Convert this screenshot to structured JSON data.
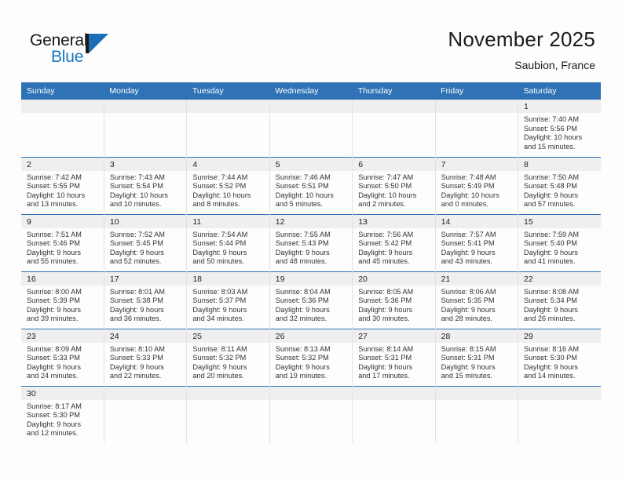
{
  "brand": {
    "name_part1": "General",
    "name_part2": "Blue",
    "triangle_color": "#1a6fb5",
    "text_color": "#1678c2"
  },
  "header": {
    "title": "November 2025",
    "location": "Saubion, France",
    "accent_color": "#2f72b5"
  },
  "calendar": {
    "weekdays": [
      "Sunday",
      "Monday",
      "Tuesday",
      "Wednesday",
      "Thursday",
      "Friday",
      "Saturday"
    ],
    "labels": {
      "sunrise": "Sunrise:",
      "sunset": "Sunset:",
      "daylight": "Daylight:"
    },
    "weeks": [
      [
        {
          "day": "",
          "empty": true
        },
        {
          "day": "",
          "empty": true
        },
        {
          "day": "",
          "empty": true
        },
        {
          "day": "",
          "empty": true
        },
        {
          "day": "",
          "empty": true
        },
        {
          "day": "",
          "empty": true
        },
        {
          "day": "1",
          "sunrise": "Sunrise: 7:40 AM",
          "sunset": "Sunset: 5:56 PM",
          "daylight_line1": "Daylight: 10 hours",
          "daylight_line2": "and 15 minutes."
        }
      ],
      [
        {
          "day": "2",
          "sunrise": "Sunrise: 7:42 AM",
          "sunset": "Sunset: 5:55 PM",
          "daylight_line1": "Daylight: 10 hours",
          "daylight_line2": "and 13 minutes."
        },
        {
          "day": "3",
          "sunrise": "Sunrise: 7:43 AM",
          "sunset": "Sunset: 5:54 PM",
          "daylight_line1": "Daylight: 10 hours",
          "daylight_line2": "and 10 minutes."
        },
        {
          "day": "4",
          "sunrise": "Sunrise: 7:44 AM",
          "sunset": "Sunset: 5:52 PM",
          "daylight_line1": "Daylight: 10 hours",
          "daylight_line2": "and 8 minutes."
        },
        {
          "day": "5",
          "sunrise": "Sunrise: 7:46 AM",
          "sunset": "Sunset: 5:51 PM",
          "daylight_line1": "Daylight: 10 hours",
          "daylight_line2": "and 5 minutes."
        },
        {
          "day": "6",
          "sunrise": "Sunrise: 7:47 AM",
          "sunset": "Sunset: 5:50 PM",
          "daylight_line1": "Daylight: 10 hours",
          "daylight_line2": "and 2 minutes."
        },
        {
          "day": "7",
          "sunrise": "Sunrise: 7:48 AM",
          "sunset": "Sunset: 5:49 PM",
          "daylight_line1": "Daylight: 10 hours",
          "daylight_line2": "and 0 minutes."
        },
        {
          "day": "8",
          "sunrise": "Sunrise: 7:50 AM",
          "sunset": "Sunset: 5:48 PM",
          "daylight_line1": "Daylight: 9 hours",
          "daylight_line2": "and 57 minutes."
        }
      ],
      [
        {
          "day": "9",
          "sunrise": "Sunrise: 7:51 AM",
          "sunset": "Sunset: 5:46 PM",
          "daylight_line1": "Daylight: 9 hours",
          "daylight_line2": "and 55 minutes."
        },
        {
          "day": "10",
          "sunrise": "Sunrise: 7:52 AM",
          "sunset": "Sunset: 5:45 PM",
          "daylight_line1": "Daylight: 9 hours",
          "daylight_line2": "and 52 minutes."
        },
        {
          "day": "11",
          "sunrise": "Sunrise: 7:54 AM",
          "sunset": "Sunset: 5:44 PM",
          "daylight_line1": "Daylight: 9 hours",
          "daylight_line2": "and 50 minutes."
        },
        {
          "day": "12",
          "sunrise": "Sunrise: 7:55 AM",
          "sunset": "Sunset: 5:43 PM",
          "daylight_line1": "Daylight: 9 hours",
          "daylight_line2": "and 48 minutes."
        },
        {
          "day": "13",
          "sunrise": "Sunrise: 7:56 AM",
          "sunset": "Sunset: 5:42 PM",
          "daylight_line1": "Daylight: 9 hours",
          "daylight_line2": "and 45 minutes."
        },
        {
          "day": "14",
          "sunrise": "Sunrise: 7:57 AM",
          "sunset": "Sunset: 5:41 PM",
          "daylight_line1": "Daylight: 9 hours",
          "daylight_line2": "and 43 minutes."
        },
        {
          "day": "15",
          "sunrise": "Sunrise: 7:59 AM",
          "sunset": "Sunset: 5:40 PM",
          "daylight_line1": "Daylight: 9 hours",
          "daylight_line2": "and 41 minutes."
        }
      ],
      [
        {
          "day": "16",
          "sunrise": "Sunrise: 8:00 AM",
          "sunset": "Sunset: 5:39 PM",
          "daylight_line1": "Daylight: 9 hours",
          "daylight_line2": "and 39 minutes."
        },
        {
          "day": "17",
          "sunrise": "Sunrise: 8:01 AM",
          "sunset": "Sunset: 5:38 PM",
          "daylight_line1": "Daylight: 9 hours",
          "daylight_line2": "and 36 minutes."
        },
        {
          "day": "18",
          "sunrise": "Sunrise: 8:03 AM",
          "sunset": "Sunset: 5:37 PM",
          "daylight_line1": "Daylight: 9 hours",
          "daylight_line2": "and 34 minutes."
        },
        {
          "day": "19",
          "sunrise": "Sunrise: 8:04 AM",
          "sunset": "Sunset: 5:36 PM",
          "daylight_line1": "Daylight: 9 hours",
          "daylight_line2": "and 32 minutes."
        },
        {
          "day": "20",
          "sunrise": "Sunrise: 8:05 AM",
          "sunset": "Sunset: 5:36 PM",
          "daylight_line1": "Daylight: 9 hours",
          "daylight_line2": "and 30 minutes."
        },
        {
          "day": "21",
          "sunrise": "Sunrise: 8:06 AM",
          "sunset": "Sunset: 5:35 PM",
          "daylight_line1": "Daylight: 9 hours",
          "daylight_line2": "and 28 minutes."
        },
        {
          "day": "22",
          "sunrise": "Sunrise: 8:08 AM",
          "sunset": "Sunset: 5:34 PM",
          "daylight_line1": "Daylight: 9 hours",
          "daylight_line2": "and 26 minutes."
        }
      ],
      [
        {
          "day": "23",
          "sunrise": "Sunrise: 8:09 AM",
          "sunset": "Sunset: 5:33 PM",
          "daylight_line1": "Daylight: 9 hours",
          "daylight_line2": "and 24 minutes."
        },
        {
          "day": "24",
          "sunrise": "Sunrise: 8:10 AM",
          "sunset": "Sunset: 5:33 PM",
          "daylight_line1": "Daylight: 9 hours",
          "daylight_line2": "and 22 minutes."
        },
        {
          "day": "25",
          "sunrise": "Sunrise: 8:11 AM",
          "sunset": "Sunset: 5:32 PM",
          "daylight_line1": "Daylight: 9 hours",
          "daylight_line2": "and 20 minutes."
        },
        {
          "day": "26",
          "sunrise": "Sunrise: 8:13 AM",
          "sunset": "Sunset: 5:32 PM",
          "daylight_line1": "Daylight: 9 hours",
          "daylight_line2": "and 19 minutes."
        },
        {
          "day": "27",
          "sunrise": "Sunrise: 8:14 AM",
          "sunset": "Sunset: 5:31 PM",
          "daylight_line1": "Daylight: 9 hours",
          "daylight_line2": "and 17 minutes."
        },
        {
          "day": "28",
          "sunrise": "Sunrise: 8:15 AM",
          "sunset": "Sunset: 5:31 PM",
          "daylight_line1": "Daylight: 9 hours",
          "daylight_line2": "and 15 minutes."
        },
        {
          "day": "29",
          "sunrise": "Sunrise: 8:16 AM",
          "sunset": "Sunset: 5:30 PM",
          "daylight_line1": "Daylight: 9 hours",
          "daylight_line2": "and 14 minutes."
        }
      ],
      [
        {
          "day": "30",
          "sunrise": "Sunrise: 8:17 AM",
          "sunset": "Sunset: 5:30 PM",
          "daylight_line1": "Daylight: 9 hours",
          "daylight_line2": "and 12 minutes."
        },
        {
          "day": "",
          "empty": true
        },
        {
          "day": "",
          "empty": true
        },
        {
          "day": "",
          "empty": true
        },
        {
          "day": "",
          "empty": true
        },
        {
          "day": "",
          "empty": true
        },
        {
          "day": "",
          "empty": true
        }
      ]
    ]
  }
}
